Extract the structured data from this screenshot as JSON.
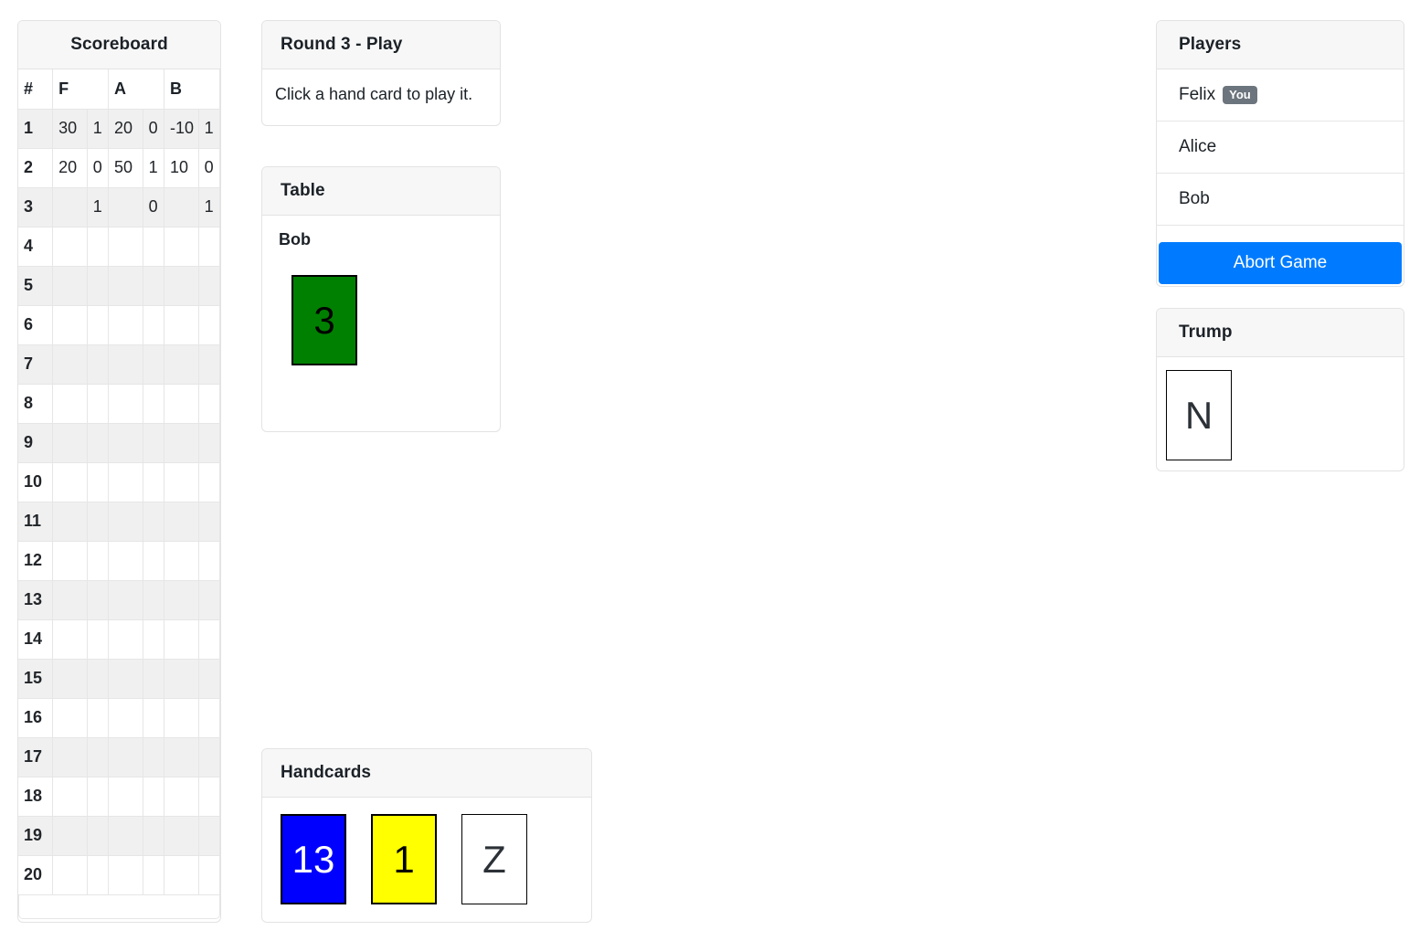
{
  "scoreboard": {
    "title": "Scoreboard",
    "headers": [
      "#",
      "F",
      "A",
      "B"
    ],
    "rows": [
      {
        "n": "1",
        "cells": [
          "30",
          "1",
          "20",
          "0",
          "-10",
          "1"
        ]
      },
      {
        "n": "2",
        "cells": [
          "20",
          "0",
          "50",
          "1",
          "10",
          "0"
        ]
      },
      {
        "n": "3",
        "cells": [
          "",
          "1",
          "",
          "0",
          "",
          "1"
        ]
      },
      {
        "n": "4",
        "cells": [
          "",
          "",
          "",
          "",
          "",
          ""
        ]
      },
      {
        "n": "5",
        "cells": [
          "",
          "",
          "",
          "",
          "",
          ""
        ]
      },
      {
        "n": "6",
        "cells": [
          "",
          "",
          "",
          "",
          "",
          ""
        ]
      },
      {
        "n": "7",
        "cells": [
          "",
          "",
          "",
          "",
          "",
          ""
        ]
      },
      {
        "n": "8",
        "cells": [
          "",
          "",
          "",
          "",
          "",
          ""
        ]
      },
      {
        "n": "9",
        "cells": [
          "",
          "",
          "",
          "",
          "",
          ""
        ]
      },
      {
        "n": "10",
        "cells": [
          "",
          "",
          "",
          "",
          "",
          ""
        ]
      },
      {
        "n": "11",
        "cells": [
          "",
          "",
          "",
          "",
          "",
          ""
        ]
      },
      {
        "n": "12",
        "cells": [
          "",
          "",
          "",
          "",
          "",
          ""
        ]
      },
      {
        "n": "13",
        "cells": [
          "",
          "",
          "",
          "",
          "",
          ""
        ]
      },
      {
        "n": "14",
        "cells": [
          "",
          "",
          "",
          "",
          "",
          ""
        ]
      },
      {
        "n": "15",
        "cells": [
          "",
          "",
          "",
          "",
          "",
          ""
        ]
      },
      {
        "n": "16",
        "cells": [
          "",
          "",
          "",
          "",
          "",
          ""
        ]
      },
      {
        "n": "17",
        "cells": [
          "",
          "",
          "",
          "",
          "",
          ""
        ]
      },
      {
        "n": "18",
        "cells": [
          "",
          "",
          "",
          "",
          "",
          ""
        ]
      },
      {
        "n": "19",
        "cells": [
          "",
          "",
          "",
          "",
          "",
          ""
        ]
      },
      {
        "n": "20",
        "cells": [
          "",
          "",
          "",
          "",
          "",
          ""
        ]
      }
    ]
  },
  "round": {
    "title": "Round 3 - Play",
    "instruction": "Click a hand card to play it."
  },
  "table": {
    "title": "Table",
    "player": "Bob",
    "cards": [
      {
        "label": "3",
        "color": "#008000",
        "text_color": "#000000"
      }
    ]
  },
  "handcards": {
    "title": "Handcards",
    "cards": [
      {
        "label": "13",
        "color": "#0000ff",
        "text_color": "#ffffff"
      },
      {
        "label": "1",
        "color": "#ffff00",
        "text_color": "#000000"
      },
      {
        "label": "Z",
        "color": "#ffffff",
        "text_color": "#2b3137"
      }
    ]
  },
  "players": {
    "title": "Players",
    "list": [
      {
        "name": "Felix",
        "badge": "You"
      },
      {
        "name": "Alice",
        "badge": ""
      },
      {
        "name": "Bob",
        "badge": ""
      }
    ],
    "abort_label": "Abort Game"
  },
  "trump": {
    "title": "Trump",
    "card": {
      "label": "N",
      "color": "#ffffff",
      "text_color": "#2b3137"
    }
  },
  "colors": {
    "accent": "#007bff",
    "badge": "#6c757d",
    "panel_header_bg": "#f7f7f7",
    "stripe": "#f0f0f0"
  }
}
